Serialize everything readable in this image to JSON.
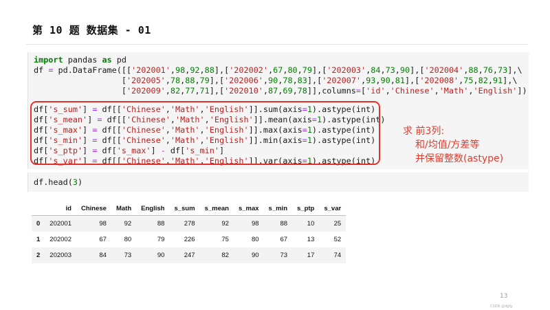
{
  "slide_title": "第 10 题  数据集 - 01",
  "code_cell_1": {
    "lines_top": [
      [
        {
          "t": "import",
          "c": "kw"
        },
        {
          "t": " pandas "
        },
        {
          "t": "as",
          "c": "kw"
        },
        {
          "t": " pd"
        }
      ],
      [
        {
          "t": "df "
        },
        {
          "t": "=",
          "c": "op"
        },
        {
          "t": " pd.DataFrame([["
        },
        {
          "t": "'202001'",
          "c": "str"
        },
        {
          "t": ","
        },
        {
          "t": "98",
          "c": "num"
        },
        {
          "t": ","
        },
        {
          "t": "92",
          "c": "num"
        },
        {
          "t": ","
        },
        {
          "t": "88",
          "c": "num"
        },
        {
          "t": "],["
        },
        {
          "t": "'202002'",
          "c": "str"
        },
        {
          "t": ","
        },
        {
          "t": "67",
          "c": "num"
        },
        {
          "t": ","
        },
        {
          "t": "80",
          "c": "num"
        },
        {
          "t": ","
        },
        {
          "t": "79",
          "c": "num"
        },
        {
          "t": "],["
        },
        {
          "t": "'202003'",
          "c": "str"
        },
        {
          "t": ","
        },
        {
          "t": "84",
          "c": "num"
        },
        {
          "t": ","
        },
        {
          "t": "73",
          "c": "num"
        },
        {
          "t": ","
        },
        {
          "t": "90",
          "c": "num"
        },
        {
          "t": "],["
        },
        {
          "t": "'202004'",
          "c": "str"
        },
        {
          "t": ","
        },
        {
          "t": "88",
          "c": "num"
        },
        {
          "t": ","
        },
        {
          "t": "76",
          "c": "num"
        },
        {
          "t": ","
        },
        {
          "t": "73",
          "c": "num"
        },
        {
          "t": "],\\"
        }
      ],
      [
        {
          "t": "                  ["
        },
        {
          "t": "'202005'",
          "c": "str"
        },
        {
          "t": ","
        },
        {
          "t": "78",
          "c": "num"
        },
        {
          "t": ","
        },
        {
          "t": "88",
          "c": "num"
        },
        {
          "t": ","
        },
        {
          "t": "79",
          "c": "num"
        },
        {
          "t": "],["
        },
        {
          "t": "'202006'",
          "c": "str"
        },
        {
          "t": ","
        },
        {
          "t": "90",
          "c": "num"
        },
        {
          "t": ","
        },
        {
          "t": "78",
          "c": "num"
        },
        {
          "t": ","
        },
        {
          "t": "83",
          "c": "num"
        },
        {
          "t": "],["
        },
        {
          "t": "'202007'",
          "c": "str"
        },
        {
          "t": ","
        },
        {
          "t": "93",
          "c": "num"
        },
        {
          "t": ","
        },
        {
          "t": "90",
          "c": "num"
        },
        {
          "t": ","
        },
        {
          "t": "81",
          "c": "num"
        },
        {
          "t": "],["
        },
        {
          "t": "'202008'",
          "c": "str"
        },
        {
          "t": ","
        },
        {
          "t": "75",
          "c": "num"
        },
        {
          "t": ","
        },
        {
          "t": "82",
          "c": "num"
        },
        {
          "t": ","
        },
        {
          "t": "91",
          "c": "num"
        },
        {
          "t": "],\\"
        }
      ],
      [
        {
          "t": "                  ["
        },
        {
          "t": "'202009'",
          "c": "str"
        },
        {
          "t": ","
        },
        {
          "t": "82",
          "c": "num"
        },
        {
          "t": ","
        },
        {
          "t": "77",
          "c": "num"
        },
        {
          "t": ","
        },
        {
          "t": "71",
          "c": "num"
        },
        {
          "t": "],["
        },
        {
          "t": "'202010'",
          "c": "str"
        },
        {
          "t": ","
        },
        {
          "t": "87",
          "c": "num"
        },
        {
          "t": ","
        },
        {
          "t": "69",
          "c": "num"
        },
        {
          "t": ","
        },
        {
          "t": "78",
          "c": "num"
        },
        {
          "t": "]],columns"
        },
        {
          "t": "=",
          "c": "op"
        },
        {
          "t": "["
        },
        {
          "t": "'id'",
          "c": "str"
        },
        {
          "t": ","
        },
        {
          "t": "'Chinese'",
          "c": "str"
        },
        {
          "t": ","
        },
        {
          "t": "'Math'",
          "c": "str"
        },
        {
          "t": ","
        },
        {
          "t": "'English'",
          "c": "str"
        },
        {
          "t": "])"
        }
      ]
    ],
    "lines_boxed": [
      [
        {
          "t": "df["
        },
        {
          "t": "'s_sum'",
          "c": "str"
        },
        {
          "t": "] "
        },
        {
          "t": "=",
          "c": "op"
        },
        {
          "t": " df[["
        },
        {
          "t": "'Chinese'",
          "c": "str"
        },
        {
          "t": ","
        },
        {
          "t": "'Math'",
          "c": "str"
        },
        {
          "t": ","
        },
        {
          "t": "'English'",
          "c": "str"
        },
        {
          "t": "]].sum(axis"
        },
        {
          "t": "=",
          "c": "op"
        },
        {
          "t": "1",
          "c": "num"
        },
        {
          "t": ").astype(int)"
        }
      ],
      [
        {
          "t": "df["
        },
        {
          "t": "'s_mean'",
          "c": "str"
        },
        {
          "t": "] "
        },
        {
          "t": "=",
          "c": "op"
        },
        {
          "t": " df[["
        },
        {
          "t": "'Chinese'",
          "c": "str"
        },
        {
          "t": ","
        },
        {
          "t": "'Math'",
          "c": "str"
        },
        {
          "t": ","
        },
        {
          "t": "'English'",
          "c": "str"
        },
        {
          "t": "]].mean(axis"
        },
        {
          "t": "=",
          "c": "op"
        },
        {
          "t": "1",
          "c": "num"
        },
        {
          "t": ").astype(int)"
        }
      ],
      [
        {
          "t": "df["
        },
        {
          "t": "'s_max'",
          "c": "str"
        },
        {
          "t": "] "
        },
        {
          "t": "=",
          "c": "op"
        },
        {
          "t": " df[["
        },
        {
          "t": "'Chinese'",
          "c": "str"
        },
        {
          "t": ","
        },
        {
          "t": "'Math'",
          "c": "str"
        },
        {
          "t": ","
        },
        {
          "t": "'English'",
          "c": "str"
        },
        {
          "t": "]].max(axis"
        },
        {
          "t": "=",
          "c": "op"
        },
        {
          "t": "1",
          "c": "num"
        },
        {
          "t": ").astype(int)"
        }
      ],
      [
        {
          "t": "df["
        },
        {
          "t": "'s_min'",
          "c": "str"
        },
        {
          "t": "] "
        },
        {
          "t": "=",
          "c": "op"
        },
        {
          "t": " df[["
        },
        {
          "t": "'Chinese'",
          "c": "str"
        },
        {
          "t": ","
        },
        {
          "t": "'Math'",
          "c": "str"
        },
        {
          "t": ","
        },
        {
          "t": "'English'",
          "c": "str"
        },
        {
          "t": "]].min(axis"
        },
        {
          "t": "=",
          "c": "op"
        },
        {
          "t": "1",
          "c": "num"
        },
        {
          "t": ").astype(int)"
        }
      ],
      [
        {
          "t": "df["
        },
        {
          "t": "'s_ptp'",
          "c": "str"
        },
        {
          "t": "] "
        },
        {
          "t": "=",
          "c": "op"
        },
        {
          "t": " df["
        },
        {
          "t": "'s_max'",
          "c": "str"
        },
        {
          "t": "] "
        },
        {
          "t": "-",
          "c": "op"
        },
        {
          "t": " df["
        },
        {
          "t": "'s_min'",
          "c": "str"
        },
        {
          "t": "]"
        }
      ],
      [
        {
          "t": "df["
        },
        {
          "t": "'s_var'",
          "c": "str"
        },
        {
          "t": "] "
        },
        {
          "t": "=",
          "c": "op"
        },
        {
          "t": " df[["
        },
        {
          "t": "'Chinese'",
          "c": "str"
        },
        {
          "t": ","
        },
        {
          "t": "'Math'",
          "c": "str"
        },
        {
          "t": ","
        },
        {
          "t": "'English'",
          "c": "str"
        },
        {
          "t": "]].var(axis"
        },
        {
          "t": "=",
          "c": "op"
        },
        {
          "t": "1",
          "c": "num"
        },
        {
          "t": ").astype(int)"
        }
      ]
    ]
  },
  "annotation": {
    "line1": "求 前3列:",
    "line2": "和/均值/方差等",
    "line3": "并保留整数(astype)",
    "color": "#e23a2a"
  },
  "code_cell_2": {
    "lines": [
      [
        {
          "t": "df.head("
        },
        {
          "t": "3",
          "c": "num"
        },
        {
          "t": ")"
        }
      ]
    ]
  },
  "dataframe": {
    "columns": [
      "",
      "id",
      "Chinese",
      "Math",
      "English",
      "s_sum",
      "s_mean",
      "s_max",
      "s_min",
      "s_ptp",
      "s_var"
    ],
    "rows": [
      [
        "0",
        "202001",
        "98",
        "92",
        "88",
        "278",
        "92",
        "98",
        "88",
        "10",
        "25"
      ],
      [
        "1",
        "202002",
        "67",
        "80",
        "79",
        "226",
        "75",
        "80",
        "67",
        "13",
        "52"
      ],
      [
        "2",
        "202003",
        "84",
        "73",
        "90",
        "247",
        "82",
        "90",
        "73",
        "17",
        "74"
      ]
    ]
  },
  "page_number": "13",
  "watermark": "CSDN @dgfg"
}
